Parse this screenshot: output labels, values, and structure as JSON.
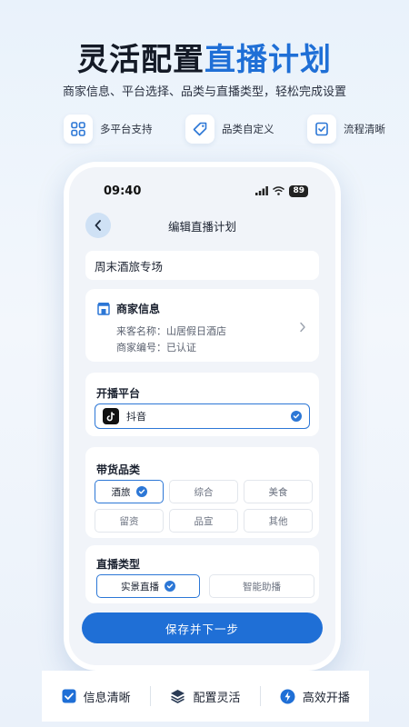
{
  "headline": {
    "part1": "灵活配置",
    "part2": "直播计划"
  },
  "subtitle": "商家信息、平台选择、品类与直播类型，轻松完成设置",
  "features": [
    {
      "label": "多平台支持",
      "icon": "grid-icon"
    },
    {
      "label": "品类自定义",
      "icon": "tag-icon"
    },
    {
      "label": "流程清晰",
      "icon": "checklist-icon"
    }
  ],
  "status": {
    "time": "09:40",
    "battery": "89"
  },
  "nav": {
    "title": "编辑直播计划"
  },
  "plan": {
    "name": "周末酒旅专场"
  },
  "merchant": {
    "title": "商家信息",
    "guest_line": "来客名称：山居假日酒店",
    "code_line": "商家编号：已认证"
  },
  "platform": {
    "title": "开播平台",
    "selected": "抖音"
  },
  "category": {
    "title": "带货品类",
    "options": [
      "酒旅",
      "综合",
      "美食",
      "留资",
      "品宣",
      "其他"
    ],
    "selected": "酒旅"
  },
  "live_type": {
    "title": "直播类型",
    "options": [
      "实景直播",
      "智能助播"
    ],
    "selected": "实景直播"
  },
  "save_label": "保存并下一步",
  "bottom_features": [
    {
      "label": "信息清晰",
      "icon": "check-square-icon"
    },
    {
      "label": "配置灵活",
      "icon": "layers-icon"
    },
    {
      "label": "高效开播",
      "icon": "lightning-icon"
    }
  ],
  "colors": {
    "accent": "#1f6fd6",
    "background": "#eaf1fa",
    "back_button": "#cfe1f5"
  }
}
